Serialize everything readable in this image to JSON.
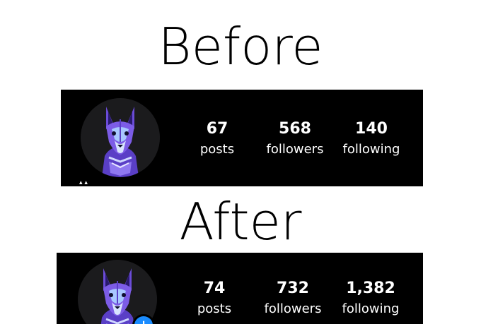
{
  "before": {
    "heading": "Before",
    "avatar_icon": "wolf-avatar-icon",
    "stats": {
      "posts": {
        "value": "67",
        "label": "posts"
      },
      "followers": {
        "value": "568",
        "label": "followers"
      },
      "following": {
        "value": "140",
        "label": "following"
      }
    }
  },
  "after": {
    "heading": "After",
    "avatar_icon": "wolf-avatar-icon",
    "add_badge_icon": "plus-icon",
    "add_badge_glyph": "+",
    "stats": {
      "posts": {
        "value": "74",
        "label": "posts"
      },
      "followers": {
        "value": "732",
        "label": "followers"
      },
      "following": {
        "value": "1,382",
        "label": "following"
      }
    }
  },
  "colors": {
    "page_background": "#ffffff",
    "strip_background": "#000000",
    "text_on_strip": "#ffffff",
    "wolf_primary": "#6b4cd8",
    "wolf_accent": "#a8c8ff",
    "badge_blue": "#1a8cff"
  }
}
